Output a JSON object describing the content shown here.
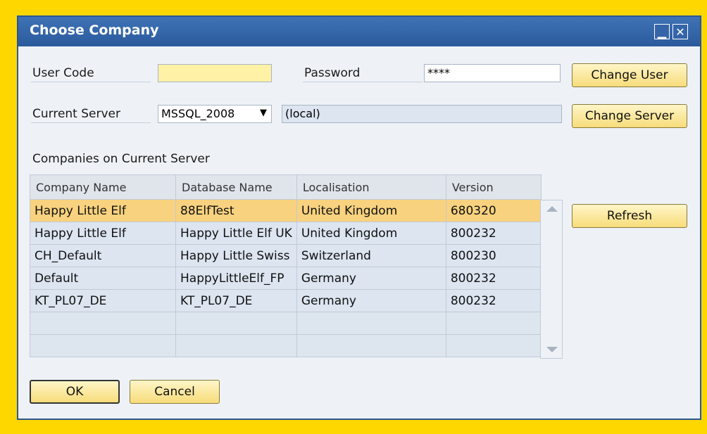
{
  "window": {
    "title": "Choose Company"
  },
  "login": {
    "user_code_label": "User Code",
    "user_code_value": "",
    "password_label": "Password",
    "password_value": "****",
    "change_user_button": "Change User"
  },
  "server": {
    "label": "Current Server",
    "selected": "MSSQL_2008",
    "host": "(local)",
    "change_server_button": "Change Server"
  },
  "companies": {
    "section_label": "Companies on Current Server",
    "columns": [
      "Company Name",
      "Database Name",
      "Localisation",
      "Version"
    ],
    "rows": [
      [
        "Happy Little Elf",
        "88ElfTest",
        "United Kingdom",
        "680320"
      ],
      [
        "Happy Little Elf",
        "Happy Little Elf UK",
        "United Kingdom",
        "800232"
      ],
      [
        "CH_Default",
        "Happy Little Swiss",
        "Switzerland",
        "800230"
      ],
      [
        "Default",
        "HappyLittleElf_FP",
        "Germany",
        "800232"
      ],
      [
        "KT_PL07_DE",
        "KT_PL07_DE",
        "Germany",
        "800232"
      ]
    ],
    "refresh_button": "Refresh"
  },
  "footer": {
    "ok_button": "OK",
    "cancel_button": "Cancel"
  },
  "colors": {
    "accent": "#2A5A9C",
    "selected_row": "#F8D27E",
    "button_fill": "#F7DC7A",
    "frame": "#FFD700"
  }
}
